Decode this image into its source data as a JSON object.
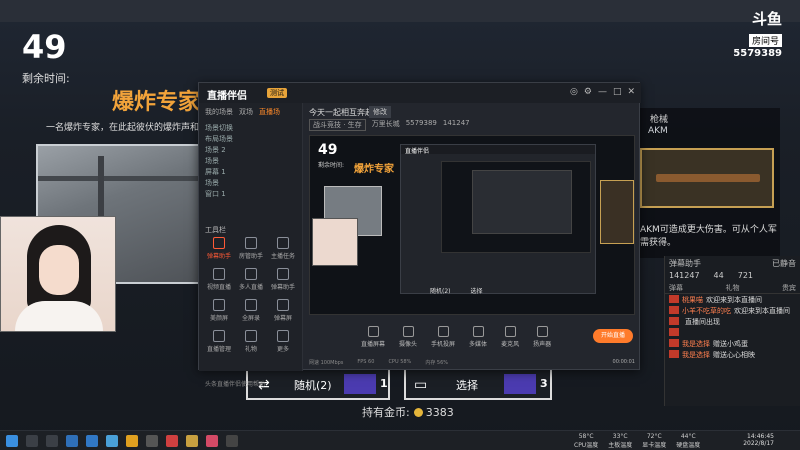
{
  "game": {
    "timer": "49",
    "remaining_label": "剩余时间:",
    "role_title": "爆炸专家",
    "role_desc": "一名爆炸专家，在此起彼伏的爆炸声和",
    "weapon_name": "枪械",
    "weapon_sub": "AKM",
    "weapon_desc": "AKM可造成更大伤害。可从个人军需获得。",
    "buttons": {
      "random_label": "随机(2)",
      "random_count": "1",
      "choose_label": "选择",
      "choose_count": "3"
    },
    "coins_label": "持有金币:",
    "coins_value": "3383"
  },
  "brand": {
    "logo": "斗鱼",
    "room_tag": "房间号",
    "room_number": "5579389"
  },
  "chat": {
    "header_left": "弹幕助手",
    "header_right": "已静音",
    "stat_viewers": "141247",
    "stat_likes": "44",
    "stat_gifts": "721",
    "tabs": [
      "弹幕",
      "礼物",
      "贵宾"
    ],
    "rows": [
      {
        "nick": "桃果喵",
        "msg": "欢迎来到本直播间"
      },
      {
        "nick": "小羊不吃草的吃",
        "msg": "欢迎来到本直播间"
      },
      {
        "nick": "",
        "msg": "直播间出现"
      },
      {
        "nick": "",
        "msg": ""
      },
      {
        "nick": "我是选择",
        "msg": "赠送小鸡蛋"
      },
      {
        "nick": "我是选择",
        "msg": "赠送心心相映"
      }
    ]
  },
  "app": {
    "logo": "直播伴侣",
    "version": "测试",
    "side_tabs": [
      "我的场景",
      "双场",
      "直播场"
    ],
    "scenes": [
      "场景切换",
      "布局场景",
      "场景 2",
      "场景",
      "屏幕 1",
      "场景",
      "窗口 1"
    ],
    "tools_title": "工具栏",
    "tools": [
      "弹幕助手",
      "房管助手",
      "主播任务",
      "视频直播",
      "多人直播",
      "弹幕助手",
      "美颜屏",
      "全屏录",
      "弹幕屏",
      "直播管理",
      "礼物",
      "更多"
    ],
    "side_footer": "头条直播伴侣使用帮助",
    "stream_title": "今天一起相互奔赴!",
    "edit_label": "修改",
    "categories": [
      "战斗竞技 · 生存",
      "万里长城",
      "5579389",
      "141247"
    ],
    "preview_timer": "49",
    "preview_remaining": "剩余时间:",
    "preview_role": "爆炸专家",
    "preview_buttons": [
      "随机(2)",
      "选择"
    ],
    "dock": [
      "直播屏幕",
      "摄像头",
      "手机投屏",
      "多媒体",
      "麦克风",
      "扬声器"
    ],
    "go_live": "开始直播",
    "status": [
      "网速 100Mbps",
      "FPS 60",
      "CPU 58%",
      "内存 56%"
    ],
    "elapsed": "00:00:01"
  },
  "taskbar": {
    "stats": [
      {
        "value": "58°C",
        "label": "CPU温度"
      },
      {
        "value": "33°C",
        "label": "主板温度"
      },
      {
        "value": "72°C",
        "label": "显卡温度"
      },
      {
        "value": "44°C",
        "label": "硬盘温度"
      }
    ],
    "time": "14:46:45",
    "date": "2022/8/17"
  }
}
